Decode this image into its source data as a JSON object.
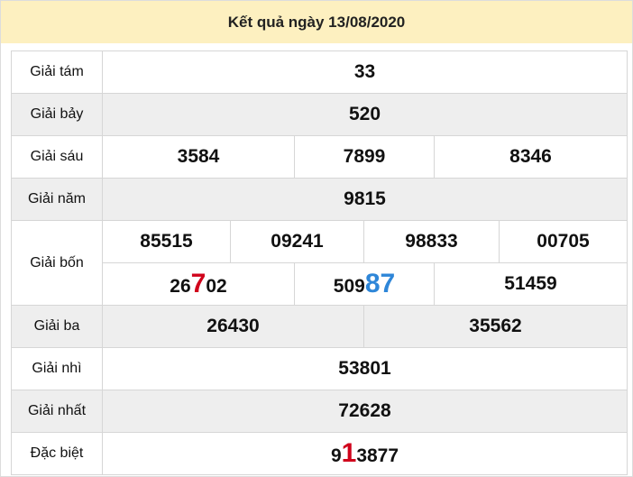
{
  "title": "Kết quả ngày 13/08/2020",
  "prizes": {
    "tam": {
      "label": "Giải tám",
      "values": [
        "33"
      ]
    },
    "bay": {
      "label": "Giải bảy",
      "values": [
        "520"
      ]
    },
    "sau": {
      "label": "Giải sáu",
      "values": [
        "3584",
        "7899",
        "8346"
      ]
    },
    "nam": {
      "label": "Giải năm",
      "values": [
        "9815"
      ]
    },
    "bon": {
      "label": "Giải bốn",
      "row1": [
        "85515",
        "09241",
        "98833",
        "00705"
      ],
      "row2": [
        {
          "pre": "26",
          "hl": "7",
          "post": "02"
        },
        {
          "pre": "509",
          "hl": "87",
          "post": ""
        },
        {
          "pre": "51459",
          "hl": "",
          "post": ""
        }
      ]
    },
    "ba": {
      "label": "Giải ba",
      "values": [
        "26430",
        "35562"
      ]
    },
    "nhi": {
      "label": "Giải nhì",
      "values": [
        "53801"
      ]
    },
    "nhat": {
      "label": "Giải nhất",
      "values": [
        "72628"
      ]
    },
    "db": {
      "label": "Đặc biệt",
      "pre": "9",
      "hl": "1",
      "post": "3877"
    }
  },
  "colors": {
    "header_bg": "#fdf0c0",
    "alt_row_bg": "#eeeeee",
    "highlight_red": "#d0021b",
    "highlight_blue": "#2e86d8"
  }
}
